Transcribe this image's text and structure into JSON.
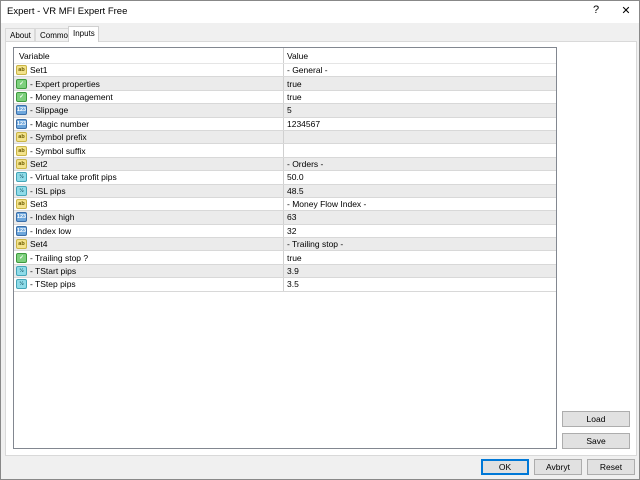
{
  "window": {
    "title": "Expert - VR MFI Expert Free",
    "help": "?",
    "close": "✕"
  },
  "tabs": [
    "About",
    "Common",
    "Inputs"
  ],
  "grid": {
    "headers": [
      "Variable",
      "Value"
    ],
    "rows": [
      {
        "icon": "ab",
        "variable": "Set1",
        "value": "- General -"
      },
      {
        "icon": "bool",
        "variable": "- Expert properties",
        "value": "true"
      },
      {
        "icon": "bool",
        "variable": "- Money management",
        "value": "true"
      },
      {
        "icon": "int",
        "variable": "- Slippage",
        "value": "5"
      },
      {
        "icon": "int",
        "variable": "- Magic number",
        "value": "1234567"
      },
      {
        "icon": "ab",
        "variable": "- Symbol prefix",
        "value": ""
      },
      {
        "icon": "ab",
        "variable": "- Symbol suffix",
        "value": ""
      },
      {
        "icon": "ab",
        "variable": "Set2",
        "value": "- Orders -"
      },
      {
        "icon": "dbl",
        "variable": "- Virtual take profit pips",
        "value": "50.0"
      },
      {
        "icon": "dbl",
        "variable": "- ISL pips",
        "value": "48.5"
      },
      {
        "icon": "ab",
        "variable": "Set3",
        "value": "- Money Flow Index -"
      },
      {
        "icon": "int",
        "variable": "- Index high",
        "value": "63"
      },
      {
        "icon": "int",
        "variable": "- Index low",
        "value": "32"
      },
      {
        "icon": "ab",
        "variable": "Set4",
        "value": "- Trailing stop -"
      },
      {
        "icon": "bool",
        "variable": "- Trailing stop ?",
        "value": "true"
      },
      {
        "icon": "dbl",
        "variable": "- TStart pips",
        "value": "3.9"
      },
      {
        "icon": "dbl",
        "variable": "- TStep pips",
        "value": "3.5"
      }
    ]
  },
  "buttons": {
    "load": "Load",
    "save": "Save",
    "ok": "OK",
    "cancel": "Avbryt",
    "reset": "Reset"
  }
}
